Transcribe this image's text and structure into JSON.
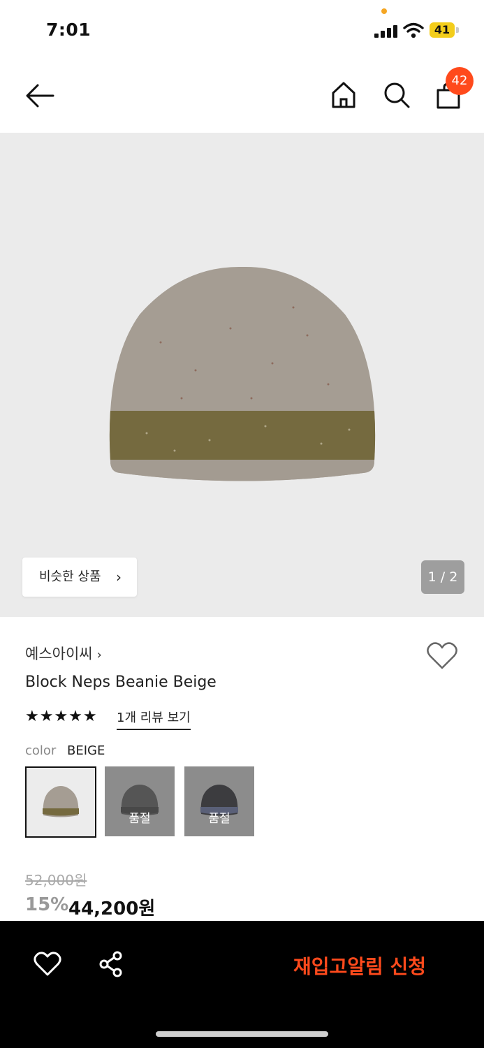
{
  "status_bar": {
    "time": "7:01",
    "battery": "41"
  },
  "header": {
    "cart_count": "42"
  },
  "hero": {
    "similar_label": "비슷한 상품",
    "similar_chevron": "›",
    "pager": "1 / 2"
  },
  "product": {
    "brand": "예스아이씨",
    "brand_chevron": "›",
    "title": "Block Neps Beanie Beige",
    "stars": "★★★★★",
    "rating": 5,
    "review_link": "1개 리뷰 보기",
    "color_label": "color",
    "color_value": "BEIGE",
    "swatches": [
      {
        "selected": true,
        "sold_out_label": ""
      },
      {
        "selected": false,
        "sold_out_label": "품절"
      },
      {
        "selected": false,
        "sold_out_label": "품절"
      }
    ],
    "original_price": "52,000원",
    "discount": "15%",
    "price": "44,200원"
  },
  "bottom_bar": {
    "restock_label": "재입고알림 신청"
  },
  "colors": {
    "accent": "#ff4a1c",
    "hero_bg": "#ebebeb",
    "bottom_bar": "#000000"
  },
  "icons": [
    "back-arrow-icon",
    "home-icon",
    "search-icon",
    "cart-icon",
    "heart-icon",
    "share-icon"
  ]
}
